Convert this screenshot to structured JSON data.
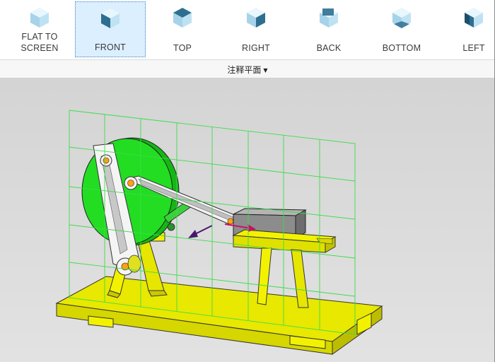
{
  "views": [
    {
      "label_line1": "FLAT TO",
      "label_line2": "SCREEN",
      "icon": "flat-to-screen-icon"
    },
    {
      "label_line1": "FRONT",
      "label_line2": "",
      "icon": "front-view-icon",
      "active": true
    },
    {
      "label_line1": "TOP",
      "label_line2": "",
      "icon": "top-view-icon"
    },
    {
      "label_line1": "RIGHT",
      "label_line2": "",
      "icon": "right-view-icon"
    },
    {
      "label_line1": "BACK",
      "label_line2": "",
      "icon": "back-view-icon"
    },
    {
      "label_line1": "BOTTOM",
      "label_line2": "",
      "icon": "bottom-view-icon"
    },
    {
      "label_line1": "LEFT",
      "label_line2": "",
      "icon": "left-view-icon"
    }
  ],
  "group": {
    "label": "注释平面"
  },
  "colors": {
    "active_bg": "#dcefff",
    "cube_light": "#bfe2f3",
    "cube_dark": "#2e6f90",
    "grid": "#3ddc4a",
    "base_yellow": "#f2f200",
    "flywheel_green": "#1fcf1f",
    "block_gray": "#8a8a8a"
  }
}
